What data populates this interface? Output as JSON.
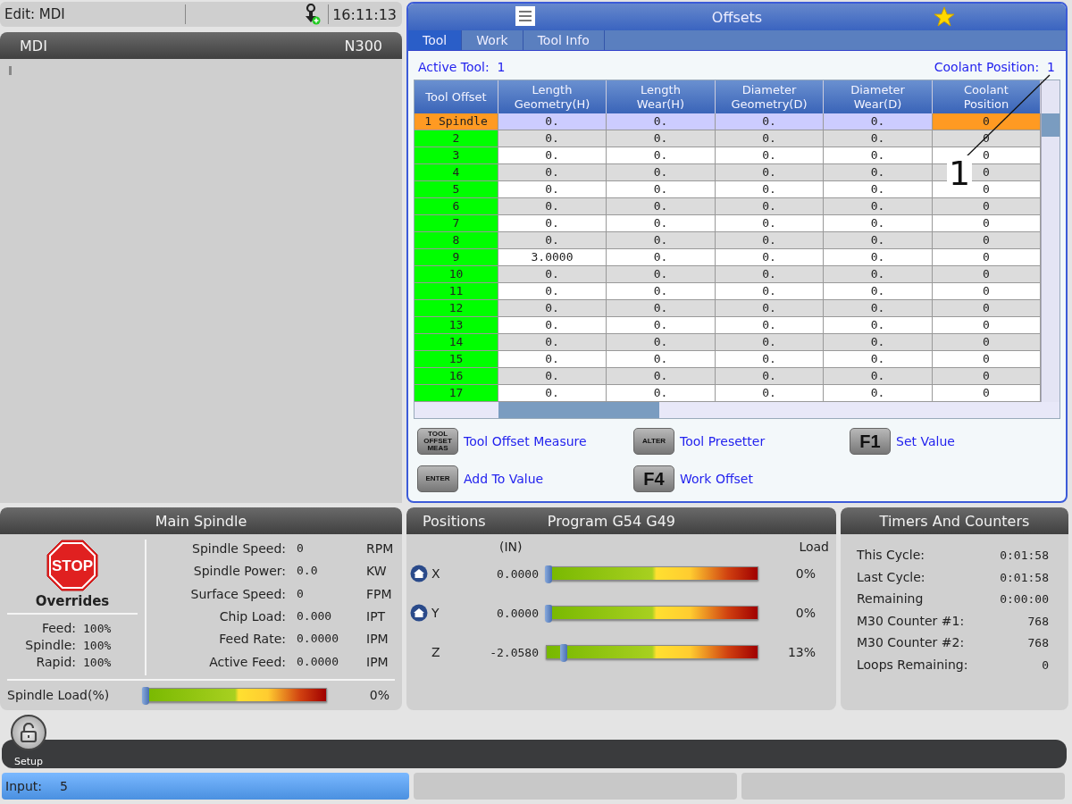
{
  "status_bar": {
    "mode": "Edit: MDI",
    "time": "16:11:13"
  },
  "mdi": {
    "title": "MDI",
    "line": "N300"
  },
  "offsets": {
    "title": "Offsets",
    "tabs": [
      {
        "label": "Tool",
        "selected": true
      },
      {
        "label": "Work",
        "selected": false
      },
      {
        "label": "Tool Info",
        "selected": false
      }
    ],
    "active_tool_label": "Active Tool:",
    "active_tool": "1",
    "coolant_label": "Coolant Position:",
    "coolant": "1",
    "columns": [
      "Tool Offset",
      "Length Geometry(H)",
      "Length Wear(H)",
      "Diameter Geometry(D)",
      "Diameter Wear(D)",
      "Coolant Position"
    ],
    "rows": [
      {
        "cells": [
          "1 Spindle",
          "0.",
          "0.",
          "0.",
          "0.",
          "0"
        ],
        "selected": true
      },
      {
        "cells": [
          "2",
          "0.",
          "0.",
          "0.",
          "0.",
          "0"
        ],
        "selected": false
      },
      {
        "cells": [
          "3",
          "0.",
          "0.",
          "0.",
          "0.",
          "0"
        ],
        "selected": false
      },
      {
        "cells": [
          "4",
          "0.",
          "0.",
          "0.",
          "0.",
          "0"
        ],
        "selected": false
      },
      {
        "cells": [
          "5",
          "0.",
          "0.",
          "0.",
          "0.",
          "0"
        ],
        "selected": false
      },
      {
        "cells": [
          "6",
          "0.",
          "0.",
          "0.",
          "0.",
          "0"
        ],
        "selected": false
      },
      {
        "cells": [
          "7",
          "0.",
          "0.",
          "0.",
          "0.",
          "0"
        ],
        "selected": false
      },
      {
        "cells": [
          "8",
          "0.",
          "0.",
          "0.",
          "0.",
          "0"
        ],
        "selected": false
      },
      {
        "cells": [
          "9",
          "3.0000",
          "0.",
          "0.",
          "0.",
          "0"
        ],
        "selected": false
      },
      {
        "cells": [
          "10",
          "0.",
          "0.",
          "0.",
          "0.",
          "0"
        ],
        "selected": false
      },
      {
        "cells": [
          "11",
          "0.",
          "0.",
          "0.",
          "0.",
          "0"
        ],
        "selected": false
      },
      {
        "cells": [
          "12",
          "0.",
          "0.",
          "0.",
          "0.",
          "0"
        ],
        "selected": false
      },
      {
        "cells": [
          "13",
          "0.",
          "0.",
          "0.",
          "0.",
          "0"
        ],
        "selected": false
      },
      {
        "cells": [
          "14",
          "0.",
          "0.",
          "0.",
          "0.",
          "0"
        ],
        "selected": false
      },
      {
        "cells": [
          "15",
          "0.",
          "0.",
          "0.",
          "0.",
          "0"
        ],
        "selected": false
      },
      {
        "cells": [
          "16",
          "0.",
          "0.",
          "0.",
          "0.",
          "0"
        ],
        "selected": false
      },
      {
        "cells": [
          "17",
          "0.",
          "0.",
          "0.",
          "0.",
          "0"
        ],
        "selected": false
      }
    ],
    "callout": "1",
    "actions": [
      {
        "key": "TOOL OFFSET MEAS",
        "label": "Tool Offset Measure",
        "kind": "small"
      },
      {
        "key": "ALTER",
        "label": "Tool Presetter",
        "kind": "small"
      },
      {
        "key": "F1",
        "label": "Set Value",
        "kind": "large"
      },
      {
        "key": "ENTER",
        "label": "Add To Value",
        "kind": "small"
      },
      {
        "key": "F4",
        "label": "Work Offset",
        "kind": "large"
      }
    ]
  },
  "spindle": {
    "title": "Main Spindle",
    "stop": "STOP",
    "overrides_title": "Overrides",
    "overrides": [
      {
        "label": "Feed:",
        "value": "100%"
      },
      {
        "label": "Spindle:",
        "value": "100%"
      },
      {
        "label": "Rapid:",
        "value": "100%"
      }
    ],
    "readings": [
      {
        "label": "Spindle Speed:",
        "value": "0",
        "unit": "RPM"
      },
      {
        "label": "Spindle Power:",
        "value": "0.0",
        "unit": "KW"
      },
      {
        "label": "Surface Speed:",
        "value": "0",
        "unit": "FPM"
      },
      {
        "label": "Chip Load:",
        "value": "0.000",
        "unit": "IPT"
      },
      {
        "label": "Feed Rate:",
        "value": "0.0000",
        "unit": "IPM"
      },
      {
        "label": "Active Feed:",
        "value": "0.0000",
        "unit": "IPM"
      }
    ],
    "load": {
      "label": "Spindle Load(%)",
      "level": 0,
      "reading": "0%"
    }
  },
  "positions": {
    "title": "Positions",
    "program": "Program G54 G49",
    "unit": "(IN)",
    "load_label": "Load",
    "axes": [
      {
        "name": "X",
        "home": true,
        "value": "0.0000",
        "level": 0,
        "load": "0%"
      },
      {
        "name": "Y",
        "home": true,
        "value": "0.0000",
        "level": 0,
        "load": "0%"
      },
      {
        "name": "Z",
        "home": false,
        "value": "-2.0580",
        "level": 0.07,
        "load": "13%"
      }
    ]
  },
  "timers": {
    "title": "Timers And Counters",
    "rows": [
      {
        "label": "This Cycle:",
        "value": "0:01:58"
      },
      {
        "label": "Last Cycle:",
        "value": "0:01:58"
      },
      {
        "label": "Remaining",
        "value": "0:00:00"
      },
      {
        "label": "M30 Counter #1:",
        "value": "768"
      },
      {
        "label": "M30 Counter #2:",
        "value": "768"
      },
      {
        "label": "Loops Remaining:",
        "value": "0"
      }
    ]
  },
  "setup": {
    "label": "Setup"
  },
  "input": {
    "label": "Input:",
    "value": "5"
  }
}
